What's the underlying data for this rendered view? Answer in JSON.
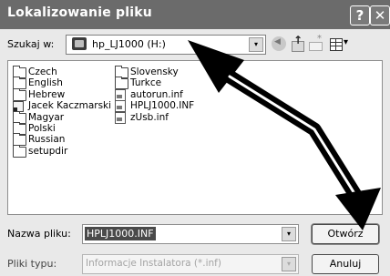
{
  "window": {
    "title": "Lokalizowanie pliku",
    "help_glyph": "?",
    "close_glyph": "✕"
  },
  "toolbar": {
    "lookin_label": "Szukaj w:",
    "lookin_value": "hp_LJ1000 (H:)",
    "dropdown_glyph": "▾"
  },
  "file_list": {
    "col1": [
      {
        "name": "Czech",
        "icon": "folder-icon"
      },
      {
        "name": "English",
        "icon": "folder-icon"
      },
      {
        "name": "Hebrew",
        "icon": "folder-icon"
      },
      {
        "name": "Jacek Kaczmarski",
        "icon": "shortcut-icon"
      },
      {
        "name": "Magyar",
        "icon": "folder-icon"
      },
      {
        "name": "Polski",
        "icon": "folder-icon"
      },
      {
        "name": "Russian",
        "icon": "folder-icon"
      },
      {
        "name": "setupdir",
        "icon": "folder-icon"
      }
    ],
    "col2": [
      {
        "name": "Slovensky",
        "icon": "folder-icon"
      },
      {
        "name": "Turkce",
        "icon": "folder-icon"
      },
      {
        "name": "autorun.inf",
        "icon": "file-icon"
      },
      {
        "name": "HPLJ1000.INF",
        "icon": "file-icon"
      },
      {
        "name": "zUsb.inf",
        "icon": "file-icon"
      }
    ]
  },
  "form": {
    "name_label": "Nazwa pliku:",
    "name_value": "HPLJ1000.INF",
    "type_label": "Pliki typu:",
    "type_value": "Informacje Instalatora (*.inf)",
    "dropdown_glyph": "▾"
  },
  "buttons": {
    "open_label": "Otwórz",
    "cancel_label": "Anuluj"
  }
}
